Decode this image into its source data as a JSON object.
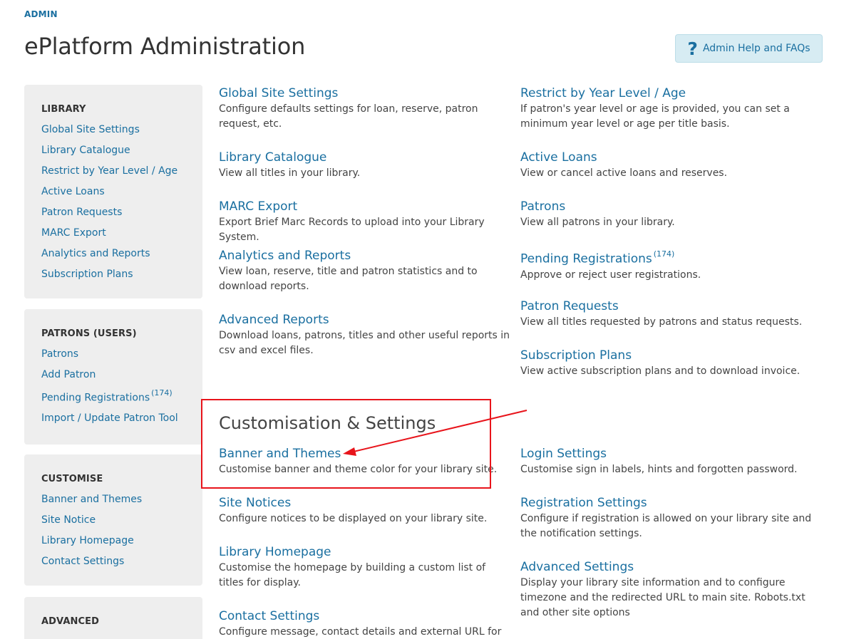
{
  "breadcrumb": "ADMIN",
  "page_title": "ePlatform Administration",
  "help_button": {
    "icon": "?",
    "label": "Admin Help and FAQs"
  },
  "colors": {
    "link": "#1a6fa0",
    "help_bg": "#d7ecf3",
    "sidebar_bg": "#eeeeee",
    "annotation": "#e8141b"
  },
  "sidebar": {
    "library": {
      "heading": "LIBRARY",
      "items": [
        "Global Site Settings",
        "Library Catalogue",
        "Restrict by Year Level / Age",
        "Active Loans",
        "Patron Requests",
        "MARC Export",
        "Analytics and Reports",
        "Subscription Plans"
      ]
    },
    "patrons": {
      "heading": "PATRONS (USERS)",
      "items": [
        "Patrons",
        "Add Patron",
        "Pending Registrations",
        "Import / Update Patron Tool"
      ],
      "pending_count": "(174)"
    },
    "customise": {
      "heading": "CUSTOMISE",
      "items": [
        "Banner and Themes",
        "Site Notice",
        "Library Homepage",
        "Contact Settings"
      ]
    },
    "advanced": {
      "heading": "ADVANCED"
    }
  },
  "library_items": {
    "left": [
      {
        "title": "Global Site Settings",
        "desc": "Configure defaults settings for loan, reserve, patron request, etc."
      },
      {
        "title": "Library Catalogue",
        "desc": "View all titles in your library."
      },
      {
        "title": "MARC Export",
        "desc": "Export Brief Marc Records to upload into your Library System."
      },
      {
        "title": "Analytics and Reports",
        "desc": "View loan, reserve, title and patron statistics and to download reports."
      },
      {
        "title": "Advanced Reports",
        "desc": "Download loans, patrons, titles and other useful reports in csv and excel files."
      }
    ],
    "right": [
      {
        "title": "Restrict by Year Level / Age",
        "desc": "If patron's year level or age is provided, you can set a minimum year level or age per title basis."
      },
      {
        "title": "Active Loans",
        "desc": "View or cancel active loans and reserves."
      },
      {
        "title": "Patrons",
        "desc": "View all patrons in your library."
      },
      {
        "title": "Pending Registrations",
        "badge": "(174)",
        "desc": "Approve or reject user registrations."
      },
      {
        "title": "Patron Requests",
        "desc": "View all titles requested by patrons and status requests."
      },
      {
        "title": "Subscription Plans",
        "desc": "View active subscription plans and to download invoice."
      }
    ]
  },
  "customisation": {
    "heading": "Customisation & Settings",
    "left": [
      {
        "title": "Banner and Themes",
        "desc": "Customise banner and theme color for your library site."
      },
      {
        "title": "Site Notices",
        "desc": "Configure notices to be displayed on your library site."
      },
      {
        "title": "Library Homepage",
        "desc": "Customise the homepage by building a custom list of titles for display."
      },
      {
        "title": "Contact Settings",
        "desc": "Configure message, contact details and external URL for the"
      }
    ],
    "right": [
      {
        "title": "Login Settings",
        "desc": "Customise sign in labels, hints and forgotten password."
      },
      {
        "title": "Registration Settings",
        "desc": "Configure if registration is allowed on your library site and the notification settings."
      },
      {
        "title": "Advanced Settings",
        "desc": "Display your library site information and to configure timezone and the redirected URL to main site. Robots.txt and other site options"
      }
    ]
  }
}
